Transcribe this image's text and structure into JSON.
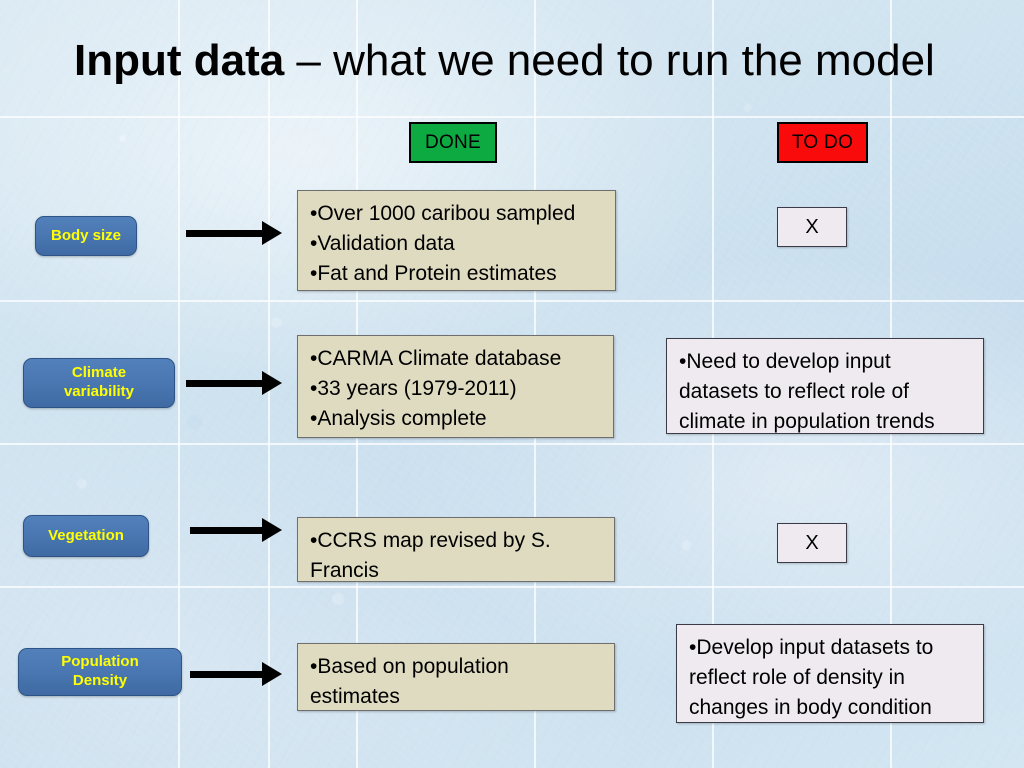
{
  "slide": {
    "title_strong": "Input data",
    "title_rest": " – what we need to run the model",
    "background_color": "#cfe2ef"
  },
  "legend": {
    "done_label": "DONE",
    "done_color": "#0daa41",
    "todo_label": "TO DO",
    "todo_color": "#fa0b0b"
  },
  "rows": [
    {
      "driver": "Body size",
      "done_lines": [
        "•Over 1000 caribou sampled",
        "•Validation data",
        "•Fat and Protein estimates"
      ],
      "todo_text": "X",
      "todo_kind": "x"
    },
    {
      "driver_line1": "Climate",
      "driver_line2": "variability",
      "done_lines": [
        "•CARMA Climate database",
        "•33 years (1979-2011)",
        "•Analysis complete"
      ],
      "todo_text": "•Need to develop input datasets to reflect role of climate in population trends",
      "todo_kind": "box"
    },
    {
      "driver": "Vegetation",
      "done_lines": [
        "•CCRS map revised by S. Francis"
      ],
      "todo_text": "X",
      "todo_kind": "x"
    },
    {
      "driver_line1": "Population",
      "driver_line2": "Density",
      "done_lines": [
        "•Based on population estimates"
      ],
      "todo_text": "•Develop input datasets to reflect role of density in changes in body condition",
      "todo_kind": "box"
    }
  ],
  "row_text": {
    "r0_l0": "•Over 1000 caribou sampled",
    "r0_l1": "•Validation data",
    "r0_l2": "•Fat and Protein estimates",
    "r1_l0": "•CARMA Climate database",
    "r1_l1": "•33 years (1979-2011)",
    "r1_l2": "•Analysis complete",
    "r2_l0": "•CCRS map revised by S. Francis",
    "r3_l0": "•Based on population estimates"
  },
  "drivers": {
    "d0": "Body size",
    "d1a": "Climate",
    "d1b": "variability",
    "d2": "Vegetation",
    "d3a": "Population",
    "d3b": "Density"
  },
  "todo": {
    "x0": "X",
    "t1": "•Need to develop input datasets to reflect role of climate in population trends",
    "x2": "X",
    "t3": "•Develop input datasets to reflect role of density in changes in body condition"
  }
}
